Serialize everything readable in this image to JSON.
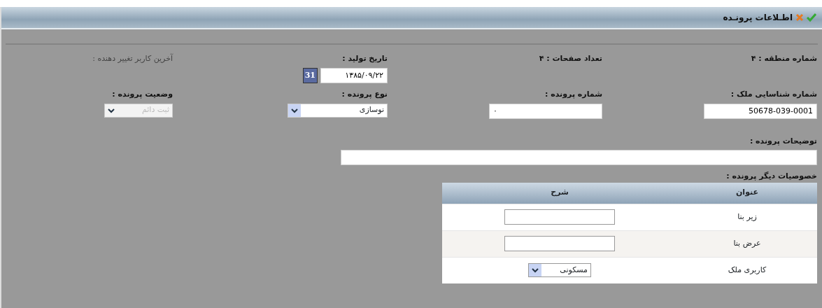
{
  "window": {
    "title": "اطـلاعات پرونـده"
  },
  "info": [
    {
      "kind": "text",
      "label": "شماره منطقه : ۴"
    },
    {
      "kind": "text",
      "label": "تعداد صفحات : ۴"
    },
    {
      "kind": "date",
      "label": "تاریخ تولید :",
      "value": "۱۳۸۵/۰۹/۲۲",
      "button": "31"
    },
    {
      "kind": "note",
      "label": "آخرین کاربر تغییر دهنده :"
    },
    {
      "kind": "input",
      "label": "شماره شناسایی ملک :",
      "value": "50678-039-0001"
    },
    {
      "kind": "input",
      "label": "شماره پرونده :",
      "value": "۰"
    },
    {
      "kind": "select",
      "label": "نوع پرونده :",
      "value": "نوسازی",
      "disabled": false
    },
    {
      "kind": "select",
      "label": "وضعیت پرونده :",
      "value": "ثبت دائم",
      "disabled": true
    }
  ],
  "description": {
    "label": "توضیحات پرونده :"
  },
  "properties": {
    "label": "خصوصیات دیگر پرونده :",
    "columns": [
      "عنوان",
      "شرح"
    ],
    "rows": [
      {
        "title": "زیر بنا",
        "kind": "input"
      },
      {
        "title": "عرض بنا",
        "kind": "input"
      },
      {
        "title": "کاربری ملک",
        "kind": "select",
        "value": "مسکونی"
      }
    ]
  }
}
